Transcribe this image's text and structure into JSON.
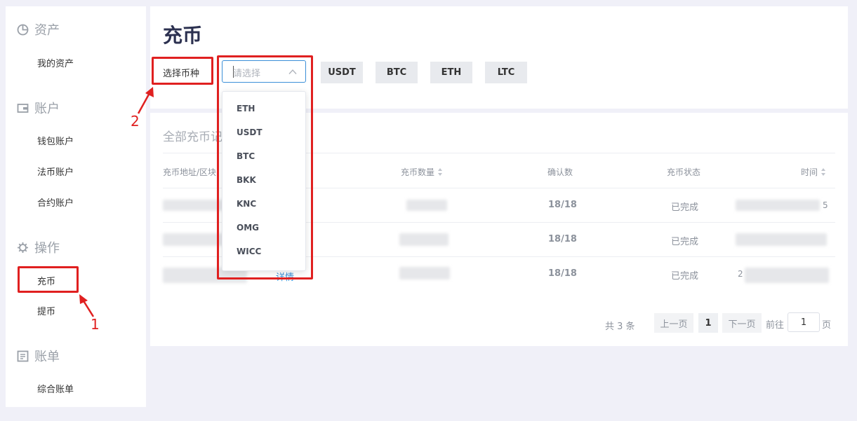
{
  "sidebar": {
    "sections": [
      {
        "title": "资产",
        "icon": "pie-chart-icon",
        "items": [
          "我的资产"
        ]
      },
      {
        "title": "账户",
        "icon": "wallet-icon",
        "items": [
          "钱包账户",
          "法币账户",
          "合约账户"
        ]
      },
      {
        "title": "操作",
        "icon": "gear-icon",
        "items": [
          "充币",
          "提币"
        ]
      },
      {
        "title": "账单",
        "icon": "bill-icon",
        "items": [
          "综合账单"
        ]
      }
    ]
  },
  "header": {
    "title": "充币",
    "select_label": "选择币种",
    "select_placeholder": "请选择",
    "coin_buttons": [
      "USDT",
      "BTC",
      "ETH",
      "LTC"
    ]
  },
  "dropdown": {
    "options": [
      "ETH",
      "USDT",
      "BTC",
      "BKK",
      "KNC",
      "OMG",
      "WICC"
    ]
  },
  "records": {
    "title": "全部充币记",
    "columns": [
      "充币地址/区块",
      "充币数量",
      "确认数",
      "充币状态",
      "时间"
    ],
    "rows": [
      {
        "confirmations": "18/18",
        "status": "已完成",
        "time_tail": "5",
        "detail": ""
      },
      {
        "confirmations": "18/18",
        "status": "已完成",
        "time_tail": "",
        "detail": ""
      },
      {
        "confirmations": "18/18",
        "status": "已完成",
        "time_tail": "2",
        "detail": "详情"
      }
    ]
  },
  "pagination": {
    "total": "共 3 条",
    "prev": "上一页",
    "current": "1",
    "next": "下一页",
    "goto": "前往",
    "page_input": "1",
    "page_suffix": "页"
  },
  "annotations": {
    "label_1": "1",
    "label_2": "2",
    "color": "#e02020"
  },
  "colors": {
    "accent": "#3b8fd8",
    "title": "#2c3150",
    "background": "#f0f0f8"
  }
}
